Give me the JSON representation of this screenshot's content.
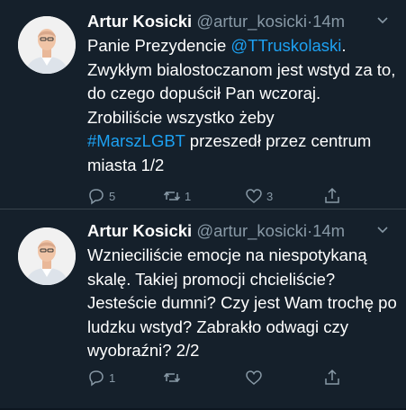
{
  "tweets": [
    {
      "name": "Artur Kosicki",
      "handle": "@artur_kosicki",
      "separator": "·",
      "time": "14m",
      "text_parts": [
        "Panie Prezydencie ",
        "@TTruskolaski",
        ".\nZwykłym bialostoczanom jest wstyd za to, do czego dopuścił Pan wczoraj. Zrobiliście wszystko żeby\n",
        "#MarszLGBT",
        " przeszedł przez centrum miasta 1/2"
      ],
      "actions": {
        "replies": "5",
        "retweets": "1",
        "likes": "3"
      }
    },
    {
      "name": "Artur Kosicki",
      "handle": "@artur_kosicki",
      "separator": "·",
      "time": "14m",
      "text": "Wznieciliście emocje na niespotykaną skalę. Takiej promocji chcieliście? Jesteście dumni? Czy jest Wam trochę po ludzku wstyd? Zabrakło odwagi czy wyobraźni? 2/2",
      "actions": {
        "replies": "1",
        "retweets": "",
        "likes": ""
      }
    }
  ],
  "icons": [
    "avatar",
    "chevron-down-icon",
    "reply-icon",
    "retweet-icon",
    "like-icon",
    "share-icon"
  ],
  "colors": {
    "background": "#15202b",
    "link": "#1da1f2",
    "muted": "#8899a6",
    "divider": "#38444d"
  }
}
